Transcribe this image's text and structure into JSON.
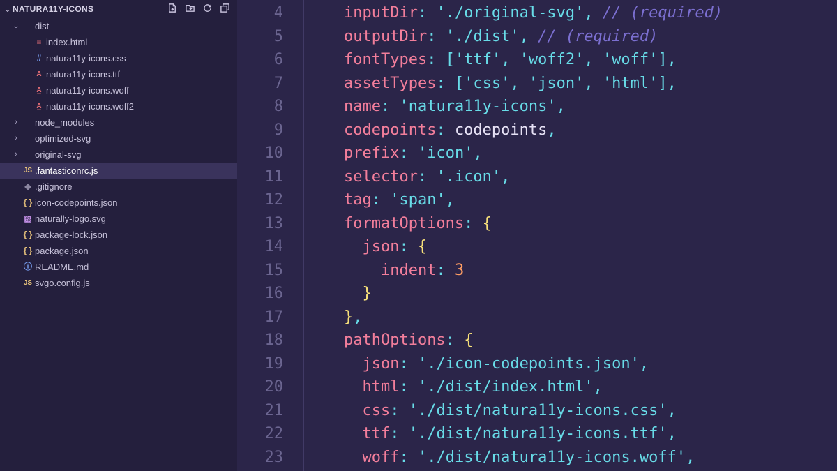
{
  "explorer": {
    "title": "NATURA11Y-ICONS",
    "tree": [
      {
        "depth": 1,
        "type": "folder",
        "open": true,
        "name": "dist"
      },
      {
        "depth": 2,
        "type": "html",
        "name": "index.html"
      },
      {
        "depth": 2,
        "type": "css",
        "name": "natura11y-icons.css"
      },
      {
        "depth": 2,
        "type": "font",
        "name": "natura11y-icons.ttf"
      },
      {
        "depth": 2,
        "type": "font",
        "name": "natura11y-icons.woff"
      },
      {
        "depth": 2,
        "type": "font",
        "name": "natura11y-icons.woff2"
      },
      {
        "depth": 1,
        "type": "folder",
        "open": false,
        "name": "node_modules"
      },
      {
        "depth": 1,
        "type": "folder",
        "open": false,
        "name": "optimized-svg"
      },
      {
        "depth": 1,
        "type": "folder",
        "open": false,
        "name": "original-svg"
      },
      {
        "depth": 1,
        "type": "js",
        "name": ".fantasticonrc.js",
        "selected": true
      },
      {
        "depth": 1,
        "type": "git",
        "name": ".gitignore"
      },
      {
        "depth": 1,
        "type": "json",
        "name": "icon-codepoints.json"
      },
      {
        "depth": 1,
        "type": "svg",
        "name": "naturally-logo.svg"
      },
      {
        "depth": 1,
        "type": "json",
        "name": "package-lock.json"
      },
      {
        "depth": 1,
        "type": "json",
        "name": "package.json"
      },
      {
        "depth": 1,
        "type": "md",
        "name": "README.md"
      },
      {
        "depth": 1,
        "type": "js",
        "name": "svgo.config.js"
      }
    ]
  },
  "iconGlyphs": {
    "folder": "",
    "html": "≡",
    "css": "#",
    "font": "A̲",
    "js": "JS",
    "json": "{ }",
    "svg": "▧",
    "md": "ⓘ",
    "git": "◆"
  },
  "editor": {
    "startLine": 4,
    "lines": [
      [
        [
          "    "
        ],
        [
          "key",
          "inputDir"
        ],
        [
          "punc",
          ": "
        ],
        [
          "str",
          "'./original-svg'"
        ],
        [
          "punc",
          ","
        ],
        [
          "ident",
          " "
        ],
        [
          "comm",
          "// (required)"
        ]
      ],
      [
        [
          "    "
        ],
        [
          "key",
          "outputDir"
        ],
        [
          "punc",
          ": "
        ],
        [
          "str",
          "'./dist'"
        ],
        [
          "punc",
          ","
        ],
        [
          "ident",
          " "
        ],
        [
          "comm",
          "// (required)"
        ]
      ],
      [
        [
          "    "
        ],
        [
          "key",
          "fontTypes"
        ],
        [
          "punc",
          ": ["
        ],
        [
          "str",
          "'ttf'"
        ],
        [
          "punc",
          ", "
        ],
        [
          "str",
          "'woff2'"
        ],
        [
          "punc",
          ", "
        ],
        [
          "str",
          "'woff'"
        ],
        [
          "punc",
          "],"
        ]
      ],
      [
        [
          "    "
        ],
        [
          "key",
          "assetTypes"
        ],
        [
          "punc",
          ": ["
        ],
        [
          "str",
          "'css'"
        ],
        [
          "punc",
          ", "
        ],
        [
          "str",
          "'json'"
        ],
        [
          "punc",
          ", "
        ],
        [
          "str",
          "'html'"
        ],
        [
          "punc",
          "],"
        ]
      ],
      [
        [
          "    "
        ],
        [
          "key",
          "name"
        ],
        [
          "punc",
          ": "
        ],
        [
          "str",
          "'natura11y-icons'"
        ],
        [
          "punc",
          ","
        ]
      ],
      [
        [
          "    "
        ],
        [
          "key",
          "codepoints"
        ],
        [
          "punc",
          ": "
        ],
        [
          "ident",
          "codepoints"
        ],
        [
          "punc",
          ","
        ]
      ],
      [
        [
          "    "
        ],
        [
          "key",
          "prefix"
        ],
        [
          "punc",
          ": "
        ],
        [
          "str",
          "'icon'"
        ],
        [
          "punc",
          ","
        ]
      ],
      [
        [
          "    "
        ],
        [
          "key",
          "selector"
        ],
        [
          "punc",
          ": "
        ],
        [
          "str",
          "'.icon'"
        ],
        [
          "punc",
          ","
        ]
      ],
      [
        [
          "    "
        ],
        [
          "key",
          "tag"
        ],
        [
          "punc",
          ": "
        ],
        [
          "str",
          "'span'"
        ],
        [
          "punc",
          ","
        ]
      ],
      [
        [
          "    "
        ],
        [
          "key",
          "formatOptions"
        ],
        [
          "punc",
          ": "
        ],
        [
          "brace",
          "{"
        ]
      ],
      [
        [
          "      "
        ],
        [
          "key",
          "json"
        ],
        [
          "punc",
          ": "
        ],
        [
          "brace",
          "{"
        ]
      ],
      [
        [
          "        "
        ],
        [
          "key",
          "indent"
        ],
        [
          "punc",
          ": "
        ],
        [
          "num",
          "3"
        ]
      ],
      [
        [
          "      "
        ],
        [
          "brace",
          "}"
        ]
      ],
      [
        [
          "    "
        ],
        [
          "brace",
          "}"
        ],
        [
          "punc",
          ","
        ]
      ],
      [
        [
          "    "
        ],
        [
          "key",
          "pathOptions"
        ],
        [
          "punc",
          ": "
        ],
        [
          "brace",
          "{"
        ]
      ],
      [
        [
          "      "
        ],
        [
          "key",
          "json"
        ],
        [
          "punc",
          ": "
        ],
        [
          "str",
          "'./icon-codepoints.json'"
        ],
        [
          "punc",
          ","
        ]
      ],
      [
        [
          "      "
        ],
        [
          "key",
          "html"
        ],
        [
          "punc",
          ": "
        ],
        [
          "str",
          "'./dist/index.html'"
        ],
        [
          "punc",
          ","
        ]
      ],
      [
        [
          "      "
        ],
        [
          "key",
          "css"
        ],
        [
          "punc",
          ": "
        ],
        [
          "str",
          "'./dist/natura11y-icons.css'"
        ],
        [
          "punc",
          ","
        ]
      ],
      [
        [
          "      "
        ],
        [
          "key",
          "ttf"
        ],
        [
          "punc",
          ": "
        ],
        [
          "str",
          "'./dist/natura11y-icons.ttf'"
        ],
        [
          "punc",
          ","
        ]
      ],
      [
        [
          "      "
        ],
        [
          "key",
          "woff"
        ],
        [
          "punc",
          ": "
        ],
        [
          "str",
          "'./dist/natura11y-icons.woff'"
        ],
        [
          "punc",
          ","
        ]
      ]
    ]
  }
}
